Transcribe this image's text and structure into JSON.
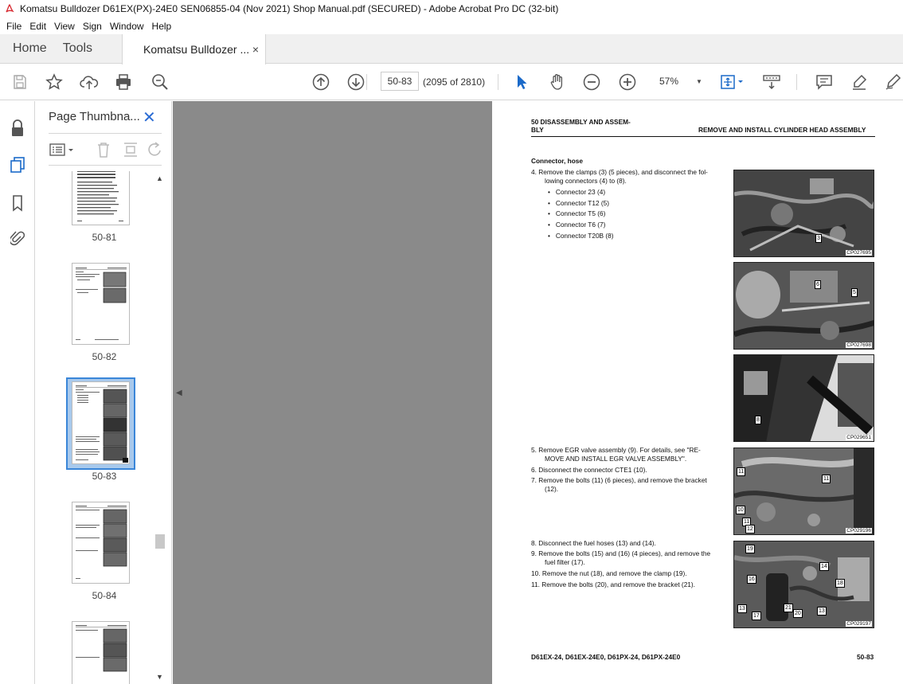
{
  "window": {
    "title": "Komatsu Bulldozer D61EX(PX)-24E0 SEN06855-04 (Nov 2021) Shop Manual.pdf (SECURED) - Adobe Acrobat Pro DC (32-bit)"
  },
  "menubar": {
    "items": [
      "File",
      "Edit",
      "View",
      "Sign",
      "Window",
      "Help"
    ]
  },
  "tabs": {
    "home": "Home",
    "tools": "Tools",
    "document": "Komatsu Bulldozer ...",
    "close": "×"
  },
  "toolbar": {
    "page_field": "50-83",
    "page_count": "(2095 of 2810)",
    "zoom": "57%",
    "icons": [
      "save-icon",
      "star-icon",
      "cloud-upload-icon",
      "print-icon",
      "zoom-search-icon",
      "page-up-icon",
      "page-down-icon",
      "select-arrow-icon",
      "hand-icon",
      "zoom-out-icon",
      "zoom-in-icon",
      "fit-page-icon",
      "scroll-mode-icon",
      "comment-icon",
      "highlight-icon",
      "sign-icon"
    ]
  },
  "thumbnails": {
    "panel_title": "Page Thumbna...",
    "pages": [
      {
        "label": "50-81"
      },
      {
        "label": "50-82"
      },
      {
        "label": "50-83",
        "selected": true
      },
      {
        "label": "50-84"
      },
      {
        "label": ""
      }
    ]
  },
  "page": {
    "header_left_line1": "50 DISASSEMBLY AND ASSEM-",
    "header_left_line2": "BLY",
    "header_right": "REMOVE AND INSTALL CYLINDER HEAD ASSEMBLY",
    "section_title": "Connector, hose",
    "step4_line1": "4.    Remove the clamps (3) (5 pieces), and disconnect the fol-",
    "step4_line2": "lowing connectors (4) to (8).",
    "connectors": [
      "Connector 23 (4)",
      "Connector T12 (5)",
      "Connector T5 (6)",
      "Connector T6 (7)",
      "Connector T20B (8)"
    ],
    "step5_line1": "5.    Remove EGR valve assembly (9). For details, see \"RE-",
    "step5_line2": "MOVE AND INSTALL EGR VALVE ASSEMBLY\".",
    "step6": "6.    Disconnect the connector CTE1 (10).",
    "step7_line1": "7.    Remove the bolts (11) (6 pieces), and remove the bracket",
    "step7_line2": "(12).",
    "step8": "8.    Disconnect the fuel hoses (13) and (14).",
    "step9_line1": "9.    Remove the bolts (15) and (16) (4 pieces), and remove the",
    "step9_line2": "fuel filter (17).",
    "step10": "10.  Remove the nut (18), and remove the clamp (19).",
    "step11": "11.  Remove the bolts (20), and remove the bracket (21).",
    "images": [
      {
        "code": "CP027695",
        "labels": [
          "3"
        ]
      },
      {
        "code": "CP027698",
        "labels": [
          "6",
          "5"
        ]
      },
      {
        "code": "CP029651",
        "labels": [
          "8"
        ]
      },
      {
        "code": "CP029196",
        "labels": [
          "11",
          "11",
          "10",
          "11",
          "12"
        ]
      },
      {
        "code": "CP029197",
        "labels": [
          "19",
          "14",
          "16",
          "18",
          "17",
          "21",
          "20",
          "13",
          "13"
        ]
      }
    ],
    "footer_left": "D61EX-24, D61EX-24E0, D61PX-24, D61PX-24E0",
    "footer_right": "50-83"
  }
}
